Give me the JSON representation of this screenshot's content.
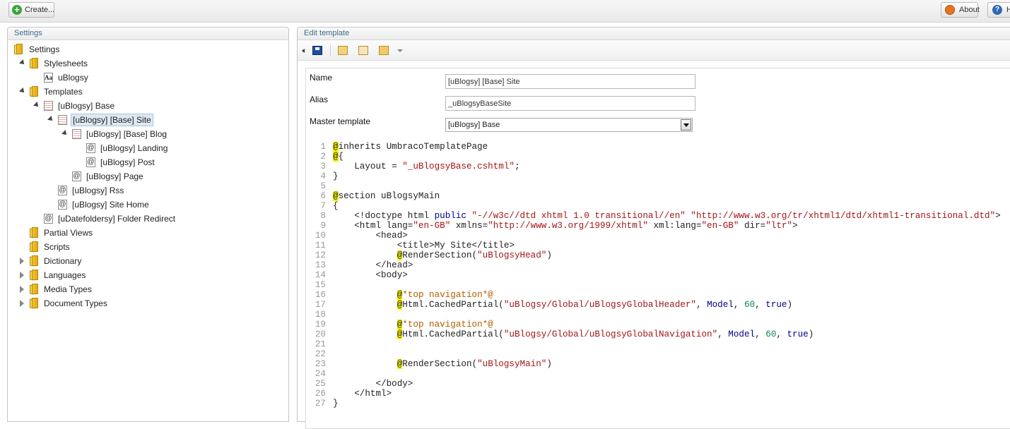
{
  "topbar": {
    "create_label": "Create...",
    "about_label": "About",
    "help_label": "H"
  },
  "settings_panel": {
    "title": "Settings",
    "tree": [
      {
        "label": "Settings",
        "icon": "folder-icon"
      },
      {
        "label": "Stylesheets",
        "icon": "folder-icon"
      },
      {
        "label": "uBlogsy",
        "icon": "stylesheet-icon"
      },
      {
        "label": "Templates",
        "icon": "folder-icon"
      },
      {
        "label": "[uBlogsy] Base",
        "icon": "template-icon"
      },
      {
        "label": "[uBlogsy] [Base] Site",
        "icon": "template-icon",
        "selected": true
      },
      {
        "label": "[uBlogsy] [Base] Blog",
        "icon": "template-icon"
      },
      {
        "label": "[uBlogsy] Landing",
        "icon": "razor-icon"
      },
      {
        "label": "[uBlogsy] Post",
        "icon": "razor-icon"
      },
      {
        "label": "[uBlogsy] Page",
        "icon": "razor-icon"
      },
      {
        "label": "[uBlogsy] Rss",
        "icon": "razor-icon"
      },
      {
        "label": "[uBlogsy] Site Home",
        "icon": "razor-icon"
      },
      {
        "label": "[uDatefoldersy] Folder Redirect",
        "icon": "razor-icon"
      },
      {
        "label": "Partial Views",
        "icon": "folder-icon"
      },
      {
        "label": "Scripts",
        "icon": "folder-icon"
      },
      {
        "label": "Dictionary",
        "icon": "folder-icon"
      },
      {
        "label": "Languages",
        "icon": "folder-icon"
      },
      {
        "label": "Media Types",
        "icon": "folder-icon"
      },
      {
        "label": "Document Types",
        "icon": "folder-icon"
      }
    ]
  },
  "edit_panel": {
    "title": "Edit template",
    "name_label": "Name",
    "name_value": "[uBlogsy] [Base] Site",
    "alias_label": "Alias",
    "alias_value": "_uBlogsyBaseSite",
    "master_label": "Master template",
    "master_value": "[uBlogsy] Base"
  },
  "code_lines": [
    "@inherits UmbracoTemplatePage",
    "@{",
    "    Layout = \"_uBlogsyBase.cshtml\";",
    "}",
    "",
    "@section uBlogsyMain",
    "{",
    "    <!doctype html public \"-//w3c//dtd xhtml 1.0 transitional//en\" \"http://www.w3.org/tr/xhtml1/dtd/xhtml1-transitional.dtd\">",
    "    <html lang=\"en-GB\" xmlns=\"http://www.w3.org/1999/xhtml\" xml:lang=\"en-GB\" dir=\"ltr\">",
    "        <head>",
    "            <title>My Site</title>",
    "            @RenderSection(\"uBlogsyHead\")",
    "        </head>",
    "        <body>",
    "",
    "            @*top navigation*@",
    "            @Html.CachedPartial(\"uBlogsy/Global/uBlogsyGlobalHeader\", Model, 60, true)",
    "",
    "            @*top navigation*@",
    "            @Html.CachedPartial(\"uBlogsy/Global/uBlogsyGlobalNavigation\", Model, 60, true)",
    "",
    "",
    "            @RenderSection(\"uBlogsyMain\")",
    "",
    "        </body>",
    "    </html>",
    "}"
  ]
}
